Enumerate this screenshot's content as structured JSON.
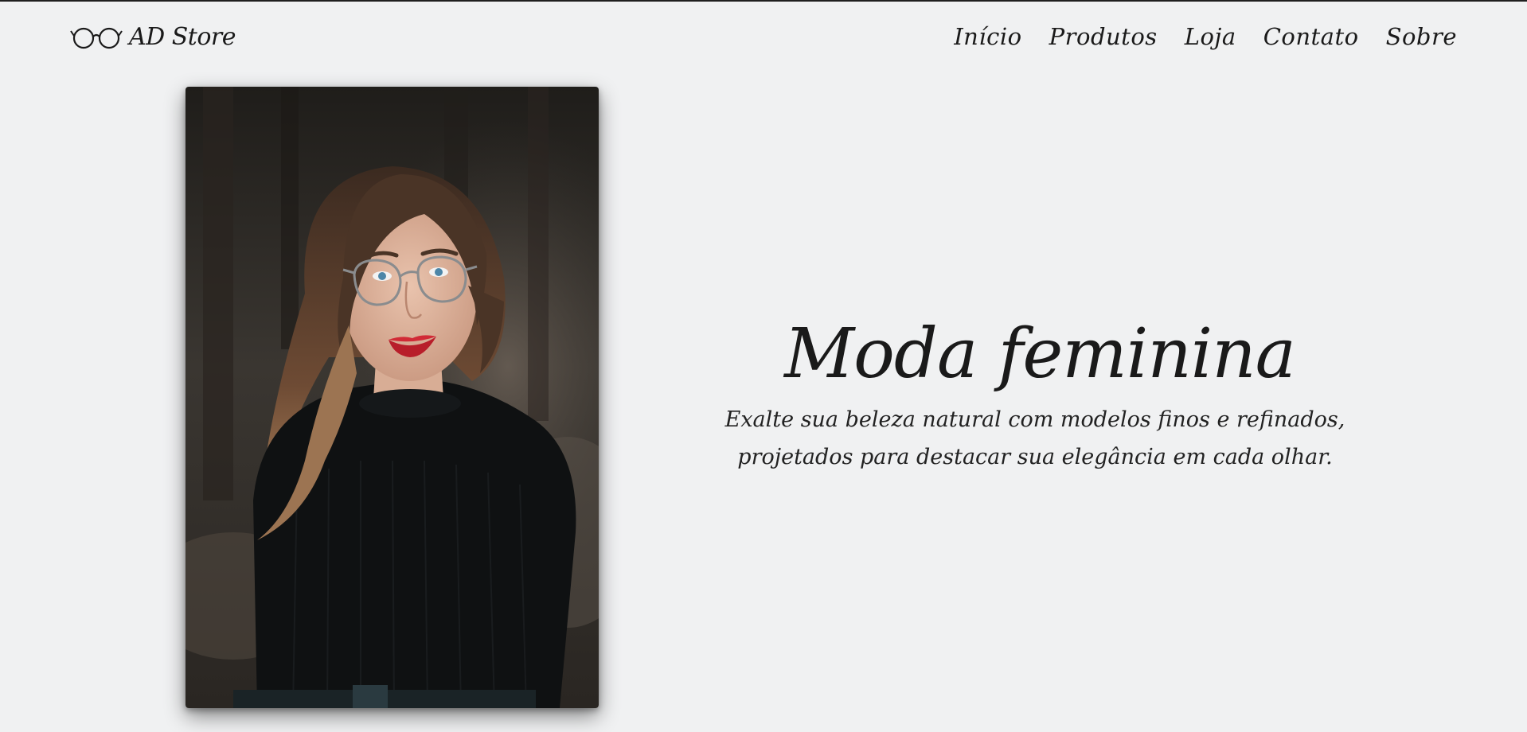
{
  "header": {
    "brand_icon": "glasses-icon",
    "brand_name": "AD Store",
    "nav": [
      "Início",
      "Produtos",
      "Loja",
      "Contato",
      "Sobre"
    ]
  },
  "hero": {
    "image": "portrait-woman-glasses",
    "title": "Moda feminina",
    "subtitle": "Exalte sua beleza natural com modelos finos e refinados, projetados para destacar sua elegância em cada olhar."
  },
  "colors": {
    "background": "#f0f1f2",
    "text": "#1a1a1a"
  }
}
